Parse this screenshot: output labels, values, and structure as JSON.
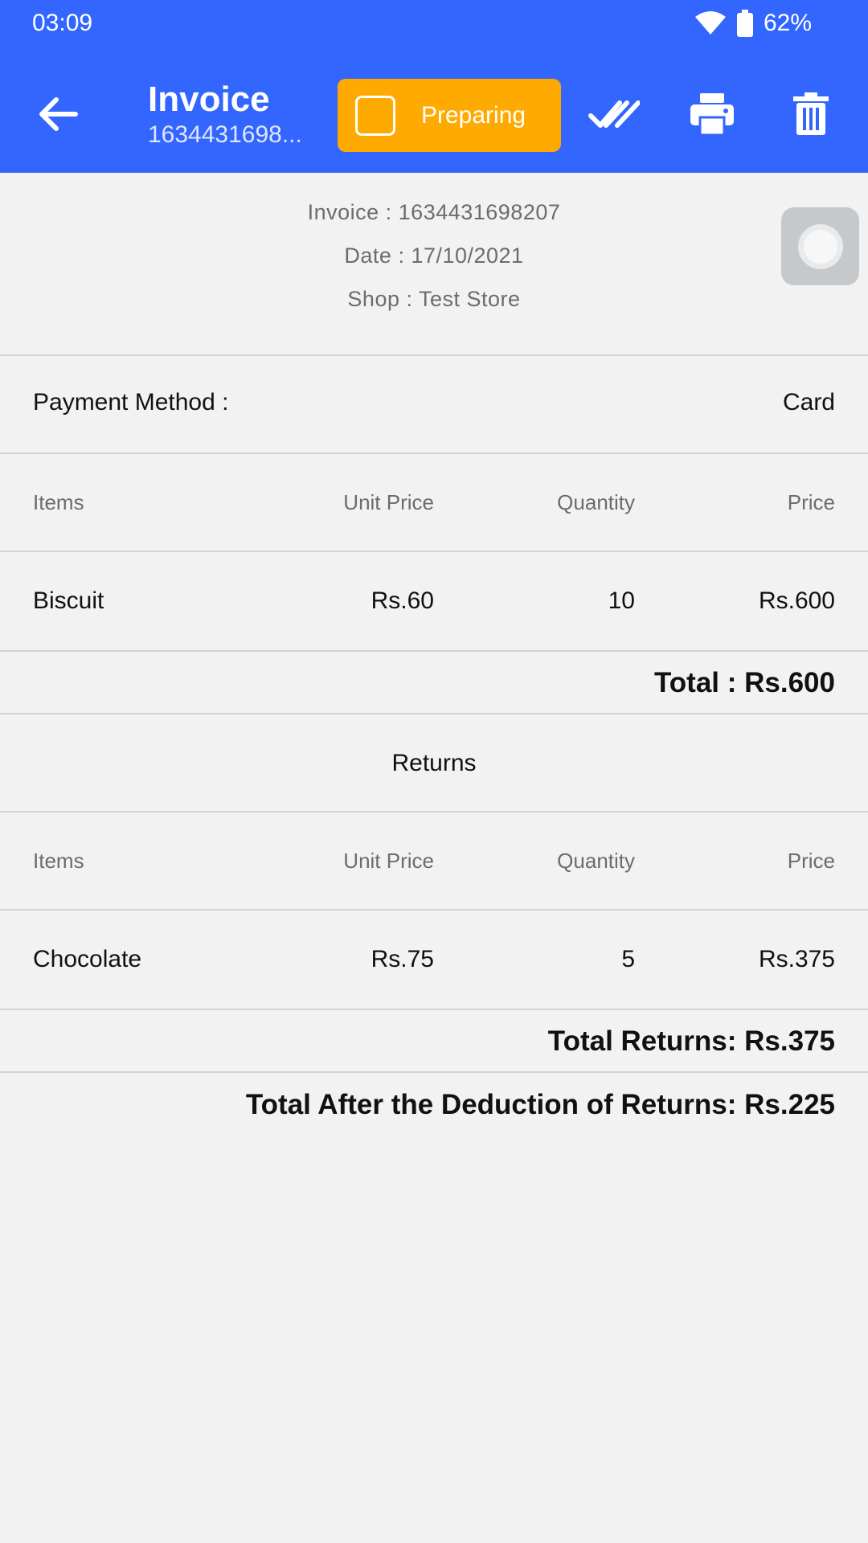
{
  "status_bar": {
    "time": "03:09",
    "battery": "62%",
    "icons": [
      "wifi-icon",
      "battery-icon"
    ]
  },
  "app_bar": {
    "title": "Invoice",
    "subtitle": "1634431698...",
    "status_chip": "Preparing",
    "actions": [
      "back-arrow-icon",
      "double-check-icon",
      "print-icon",
      "trash-icon"
    ]
  },
  "invoice": {
    "invoice_line": "Invoice : 1634431698207",
    "date_line": "Date : 17/10/2021",
    "shop_line": "Shop : Test Store"
  },
  "payment": {
    "label": "Payment Method :",
    "value": "Card"
  },
  "items_table": {
    "headers": [
      "Items",
      "Unit Price",
      "Quantity",
      "Price"
    ],
    "rows": [
      {
        "item": "Biscuit",
        "unit_price": "Rs.60",
        "quantity": "10",
        "price": "Rs.600"
      }
    ],
    "total": "Total : Rs.600"
  },
  "returns": {
    "title": "Returns",
    "headers": [
      "Items",
      "Unit Price",
      "Quantity",
      "Price"
    ],
    "rows": [
      {
        "item": "Chocolate",
        "unit_price": "Rs.75",
        "quantity": "5",
        "price": "Rs.375"
      }
    ],
    "total": "Total Returns: Rs.375"
  },
  "final_total": "Total After the Deduction of Returns: Rs.225",
  "colors": {
    "primary": "#3366ff",
    "chip": "#ffaa00",
    "background": "#f2f2f2"
  }
}
